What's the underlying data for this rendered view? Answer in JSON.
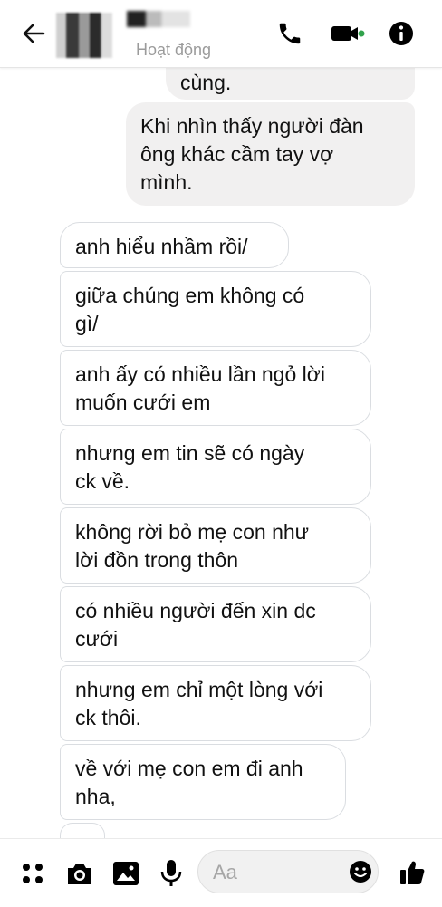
{
  "header": {
    "status_text": "Hoạt động",
    "icons": {
      "back": "arrow-left-icon",
      "call": "phone-icon",
      "video": "video-camera-icon",
      "info": "info-icon"
    },
    "active_dot_color": "#31a24c"
  },
  "messages": [
    {
      "side": "sent",
      "text": "cùng."
    },
    {
      "side": "sent",
      "text": "Khi nhìn thấy người đàn\nông khác cầm tay vợ\nmình."
    },
    {
      "side": "received",
      "text": "anh hiểu nhầm rồi/"
    },
    {
      "side": "received",
      "text": "giữa chúng em không có\ngì/"
    },
    {
      "side": "received",
      "text": "anh ấy có nhiều lần ngỏ lời\nmuốn cưới em"
    },
    {
      "side": "received",
      "text": "nhưng em tin sẽ có ngày\nck về."
    },
    {
      "side": "received",
      "text": "không rời bỏ mẹ con như\nlời đồn trong thôn"
    },
    {
      "side": "received",
      "text": "có nhiều người đến xin dc\ncưới"
    },
    {
      "side": "received",
      "text": "nhưng em chỉ một lòng với\nck thôi."
    },
    {
      "side": "received",
      "text": "về với mẹ con em đi anh\nnha,"
    }
  ],
  "composer": {
    "placeholder": "Aa",
    "icons": [
      "apps-grid-icon",
      "camera-icon",
      "image-icon",
      "microphone-icon",
      "emoji-icon",
      "thumbs-up-icon"
    ],
    "accent_color": "#000000"
  }
}
